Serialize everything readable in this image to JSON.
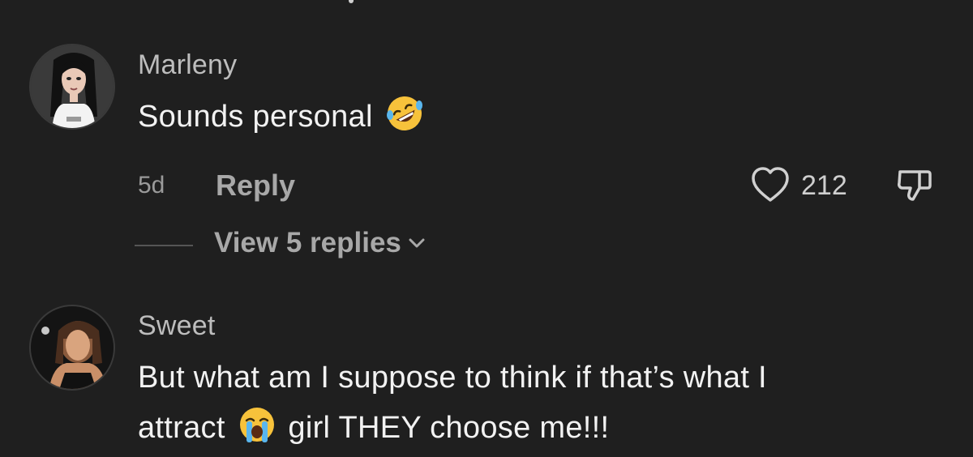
{
  "comments": [
    {
      "username": "Marleny",
      "text": "Sounds personal",
      "text_emoji": "rolling-on-floor-laughing-emoji",
      "time": "5d",
      "reply_label": "Reply",
      "likes": "212",
      "view_replies_label": "View 5 replies"
    },
    {
      "username": "Sweet",
      "text_line1": "But what am I suppose to think if that’s what I",
      "text_line2_a": "attract",
      "text_line2_emoji": "loudly-crying-face-emoji",
      "text_line2_b": "girl THEY choose me!!!"
    }
  ],
  "icons": {
    "like": "heart-outline-icon",
    "dislike": "thumbs-down-outline-icon",
    "chevron": "chevron-down-icon"
  },
  "colors": {
    "background": "#1f1f1f",
    "username": "#bdbdbd",
    "body_text": "#f2f2f2",
    "muted": "#a8a8a8"
  }
}
